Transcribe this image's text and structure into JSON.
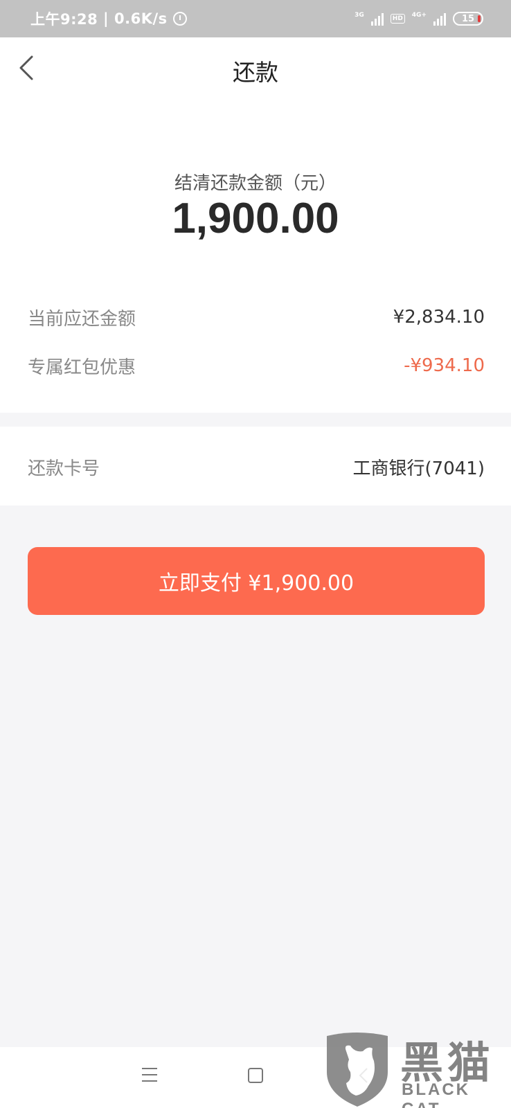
{
  "status_bar": {
    "time": "上午9:28",
    "speed": "0.6K/s",
    "sig1_label": "3G",
    "hd_label": "HD",
    "sig2_label": "4G+",
    "battery": "15"
  },
  "header": {
    "title": "还款"
  },
  "amount": {
    "label": "结清还款金额（元）",
    "value": "1,900.00"
  },
  "rows": {
    "current_due_label": "当前应还金额",
    "current_due_value": "¥2,834.10",
    "discount_label": "专属红包优惠",
    "discount_value": "-¥934.10"
  },
  "card": {
    "label": "还款卡号",
    "value": "工商银行(7041)"
  },
  "pay_button": {
    "label": "立即支付 ¥1,900.00"
  },
  "watermark": {
    "cn": "黑猫",
    "en": "BLACK CAT"
  },
  "colors": {
    "accent": "#fd6a4f",
    "discount": "#ee6a4c"
  }
}
